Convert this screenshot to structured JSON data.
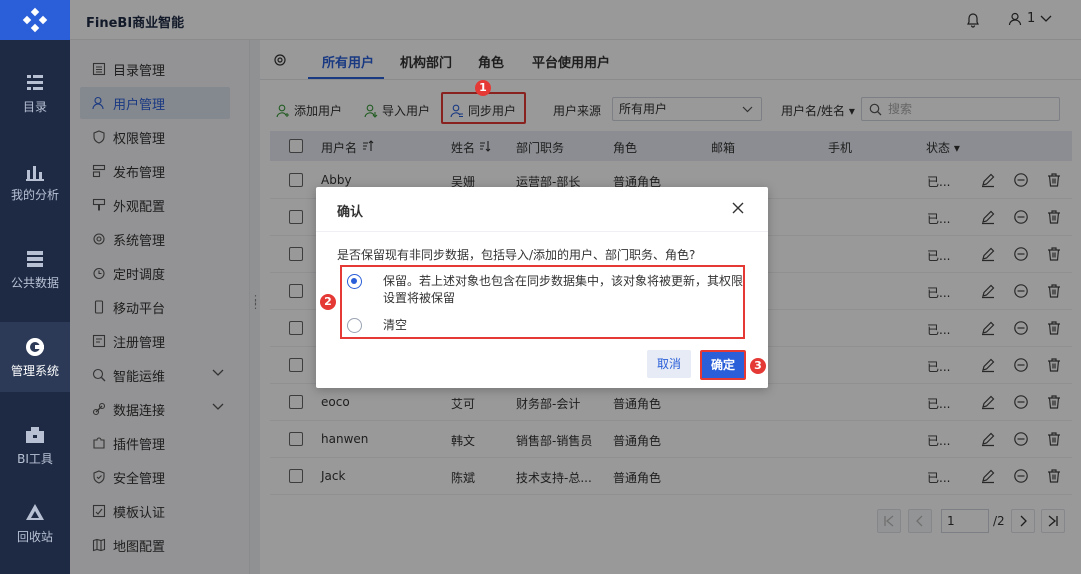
{
  "app": {
    "title": "FineBI商业智能",
    "user": "1"
  },
  "rail": [
    {
      "label": "目录",
      "icon": "catalog-icon"
    },
    {
      "label": "我的分析",
      "icon": "analysis-icon"
    },
    {
      "label": "公共数据",
      "icon": "public-data-icon"
    },
    {
      "label": "管理系统",
      "icon": "management-icon",
      "active": true
    },
    {
      "label": "BI工具",
      "icon": "toolbox-icon"
    },
    {
      "label": "回收站",
      "icon": "recycle-icon"
    }
  ],
  "sidebar": {
    "items": [
      {
        "label": "目录管理"
      },
      {
        "label": "用户管理"
      },
      {
        "label": "权限管理"
      },
      {
        "label": "发布管理"
      },
      {
        "label": "外观配置"
      },
      {
        "label": "系统管理"
      },
      {
        "label": "定时调度"
      },
      {
        "label": "移动平台"
      },
      {
        "label": "注册管理"
      },
      {
        "label": "智能运维"
      },
      {
        "label": "数据连接"
      },
      {
        "label": "插件管理"
      },
      {
        "label": "安全管理"
      },
      {
        "label": "模板认证"
      },
      {
        "label": "地图配置"
      }
    ]
  },
  "tabs": [
    "所有用户",
    "机构部门",
    "角色",
    "平台使用用户"
  ],
  "toolbar": {
    "add_user": "添加用户",
    "import_user": "导入用户",
    "sync_user": "同步用户",
    "source_label": "用户来源",
    "source_value": "所有用户",
    "name_filter": "用户名/姓名",
    "search_placeholder": "搜索"
  },
  "table": {
    "headers": [
      "用户名",
      "姓名",
      "部门职务",
      "角色",
      "邮箱",
      "手机",
      "状态"
    ],
    "rows": [
      {
        "username": "Abby",
        "name": "吴姗",
        "dept": "运营部-部长",
        "role": "普通角色",
        "status": "已..."
      },
      {
        "username": "",
        "name": "",
        "dept": "",
        "role": "",
        "status": "已..."
      },
      {
        "username": "",
        "name": "",
        "dept": "",
        "role": "",
        "status": "已..."
      },
      {
        "username": "",
        "name": "",
        "dept": "",
        "role": "",
        "status": "已..."
      },
      {
        "username": "",
        "name": "",
        "dept": "",
        "role": "",
        "status": "已..."
      },
      {
        "username": "",
        "name": "",
        "dept": "",
        "role": "",
        "status": "已..."
      },
      {
        "username": "eoco",
        "name": "艾可",
        "dept": "财务部-会计",
        "role": "普通角色",
        "status": "已..."
      },
      {
        "username": "hanwen",
        "name": "韩文",
        "dept": "销售部-销售员",
        "role": "普通角色",
        "status": "已..."
      },
      {
        "username": "Jack",
        "name": "陈斌",
        "dept": "技术支持-总...",
        "role": "普通角色",
        "status": "已..."
      }
    ]
  },
  "pager": {
    "current": "1",
    "total": "/2"
  },
  "dialog": {
    "title": "确认",
    "question": "是否保留现有非同步数据，包括导入/添加的用户、部门职务、角色?",
    "option_keep_line1": "保留。若上述对象也包含在同步数据集中，该对象将被更新，其权限",
    "option_keep_line2": "设置将被保留",
    "option_clear": "清空",
    "cancel": "取消",
    "ok": "确定"
  },
  "badges": [
    "1",
    "2",
    "3"
  ],
  "colors": {
    "accent": "#2b5fd9",
    "highlight": "#e53935",
    "rail": "#1e2a44"
  }
}
